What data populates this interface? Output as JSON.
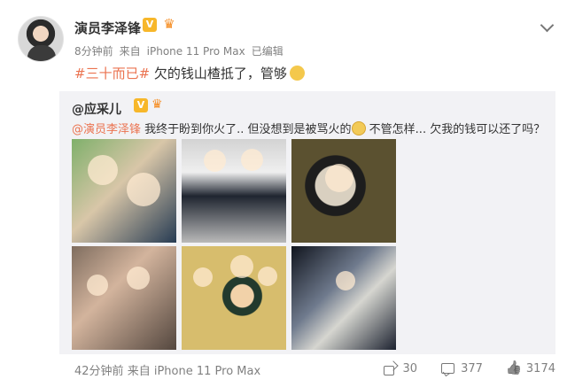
{
  "post": {
    "author": "演员李泽锋",
    "meta": {
      "time": "8分钟前",
      "source_prefix": "来自",
      "source": "iPhone 11 Pro Max",
      "edited": "已编辑"
    },
    "content": {
      "hashtag": "#三十而已#",
      "text": " 欠的钱山楂抵了，管够"
    }
  },
  "repost": {
    "author": "@应采儿",
    "mention": "@演员李泽锋",
    "text": " 我终于盼到你火了.. 但没想到是被骂火的",
    "text_after": " 不管怎样... 欠我的钱可以还了吗？"
  },
  "footer": {
    "time": "42分钟前",
    "source_prefix": "来自",
    "source": "iPhone 11 Pro Max",
    "shares": "30",
    "comments": "377",
    "likes": "3174"
  },
  "icons": {
    "avatar": "avatar",
    "verified": "verified-badge",
    "vip": "vip-badge-icon",
    "share": "share-icon",
    "comment": "comment-icon",
    "like": "like-icon",
    "dropdown": "chevron-down-icon"
  },
  "colors": {
    "accent": "#eb7350",
    "gold": "#f7b72a",
    "muted": "#808080",
    "repost_bg": "#f2f2f5"
  }
}
